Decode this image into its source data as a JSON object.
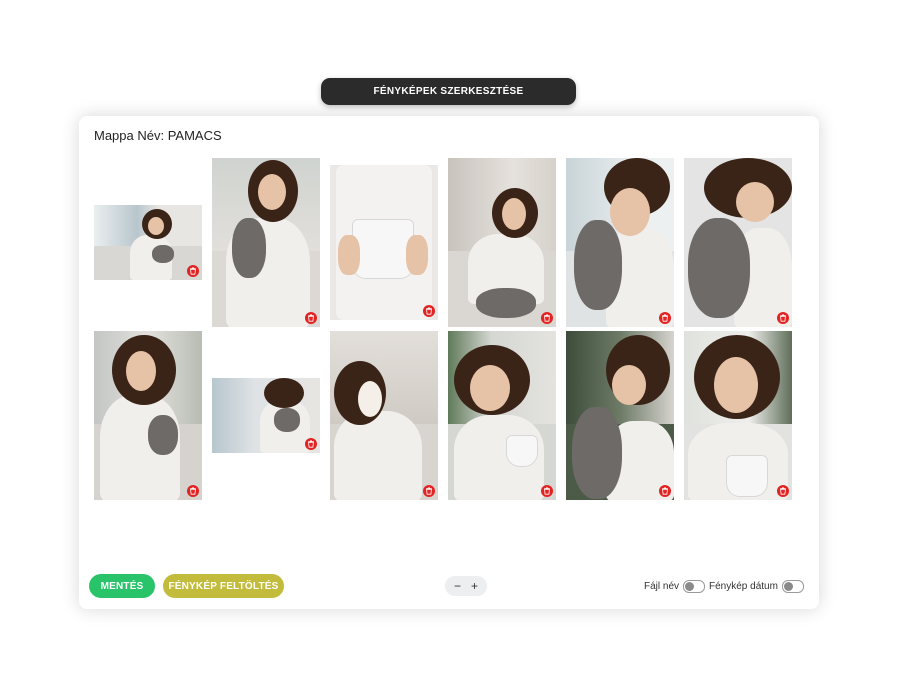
{
  "header": {
    "title": "FÉNYKÉPEK SZERKESZTÉSE"
  },
  "folder": {
    "label": "Mappa Név: PAMACS"
  },
  "photos": [
    {
      "subject": "woman holding cat by window",
      "delete_icon": "trash-icon"
    },
    {
      "subject": "woman smiling holding cat",
      "delete_icon": "trash-icon"
    },
    {
      "subject": "hands holding cup of cream",
      "delete_icon": "trash-icon"
    },
    {
      "subject": "woman on bed with phone and cat",
      "delete_icon": "trash-icon"
    },
    {
      "subject": "woman kissing cat by window",
      "delete_icon": "trash-icon"
    },
    {
      "subject": "woman hugging cat",
      "delete_icon": "trash-icon"
    },
    {
      "subject": "woman standing with cat",
      "delete_icon": "trash-icon"
    },
    {
      "subject": "woman sitting with cat",
      "delete_icon": "trash-icon"
    },
    {
      "subject": "woman with face mask and phone",
      "delete_icon": "trash-icon"
    },
    {
      "subject": "woman smelling drink",
      "delete_icon": "trash-icon"
    },
    {
      "subject": "woman kissing cat",
      "delete_icon": "trash-icon"
    },
    {
      "subject": "woman laughing with mug",
      "delete_icon": "trash-icon"
    }
  ],
  "footer": {
    "save_label": "MENTÉS",
    "upload_label": "FÉNYKÉP FELTÖLTÉS",
    "zoom_out": "−",
    "zoom_in": "+",
    "filename_label": "Fájl név",
    "photo_date_label": "Fénykép dátum"
  },
  "colors": {
    "save": "#29c36a",
    "upload": "#c3bb3c",
    "delete": "#e02424",
    "header": "#2b2b2b"
  }
}
